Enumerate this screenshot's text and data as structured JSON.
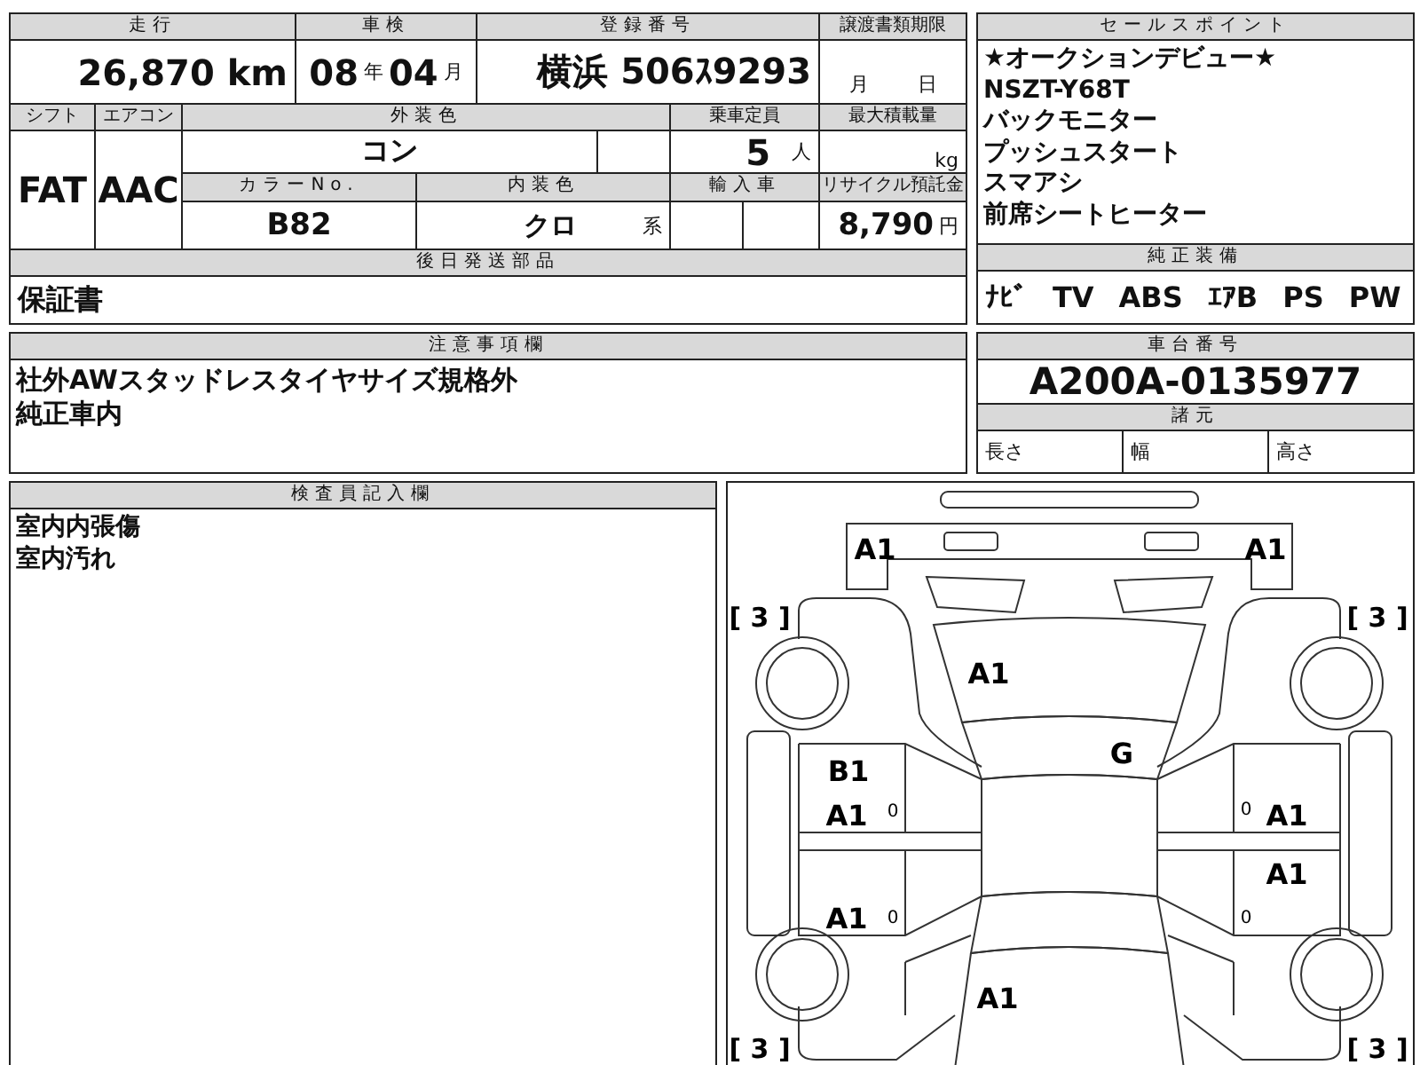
{
  "mileage": {
    "label": "走行",
    "value": "26,870",
    "unit": "km"
  },
  "inspection": {
    "label": "車検",
    "year": "08",
    "year_unit": "年",
    "month": "04",
    "month_unit": "月"
  },
  "registration": {
    "label": "登録番号",
    "region": "横浜",
    "number": "506ｽ9293"
  },
  "transfer_deadline": {
    "label": "譲渡書類期限",
    "month_unit": "月",
    "day_unit": "日"
  },
  "shift": {
    "label": "シフト",
    "value": "FAT"
  },
  "aircon": {
    "label": "エアコン",
    "value": "AAC"
  },
  "exterior_color": {
    "label": "外装色",
    "value": "コン"
  },
  "capacity": {
    "label": "乗車定員",
    "value": "5",
    "unit": "人"
  },
  "max_load": {
    "label": "最大積載量",
    "unit": "kg"
  },
  "color_no": {
    "label": "カラーNo.",
    "value": "B82"
  },
  "interior_color": {
    "label": "内装色",
    "value": "クロ",
    "suffix": "系"
  },
  "import_car": {
    "label": "輸入車"
  },
  "recycle_fee": {
    "label": "リサイクル預託金",
    "value": "8,790",
    "unit": "円"
  },
  "later_parts": {
    "label": "後日発送部品",
    "value": "保証書"
  },
  "sale_points": {
    "label": "セールスポイント",
    "lines": [
      "★オークションデビュー★",
      "NSZT-Y68T",
      "バックモニター",
      "プッシュスタート",
      "スマアシ",
      "前席シートヒーター"
    ]
  },
  "standard_equipment": {
    "label": "純正装備",
    "items": [
      "ﾅﾋﾞ",
      "TV",
      "ABS",
      "ｴｱB",
      "PS",
      "PW"
    ]
  },
  "notes": {
    "label": "注意事項欄",
    "lines": [
      "社外AWスタッドレスタイヤサイズ規格外",
      "純正車内"
    ]
  },
  "chassis": {
    "label": "車台番号",
    "value": "A200A-0135977"
  },
  "specs": {
    "label": "諸元",
    "fields": [
      "長さ",
      "幅",
      "高さ"
    ]
  },
  "inspector": {
    "label": "検査員記入欄",
    "lines": [
      "室内内張傷",
      "室内汚れ"
    ]
  },
  "diagram": {
    "marks": [
      "A1",
      "A1",
      "A1",
      "G",
      "B1",
      "A1",
      "A1",
      "A1",
      "A1",
      "A1"
    ],
    "tire_marks": [
      "[ 3 ]",
      "[ 3 ]",
      "[ 3 ]",
      "[ 3 ]"
    ],
    "tread_marks": [
      "0",
      "0",
      "0",
      "0"
    ]
  }
}
